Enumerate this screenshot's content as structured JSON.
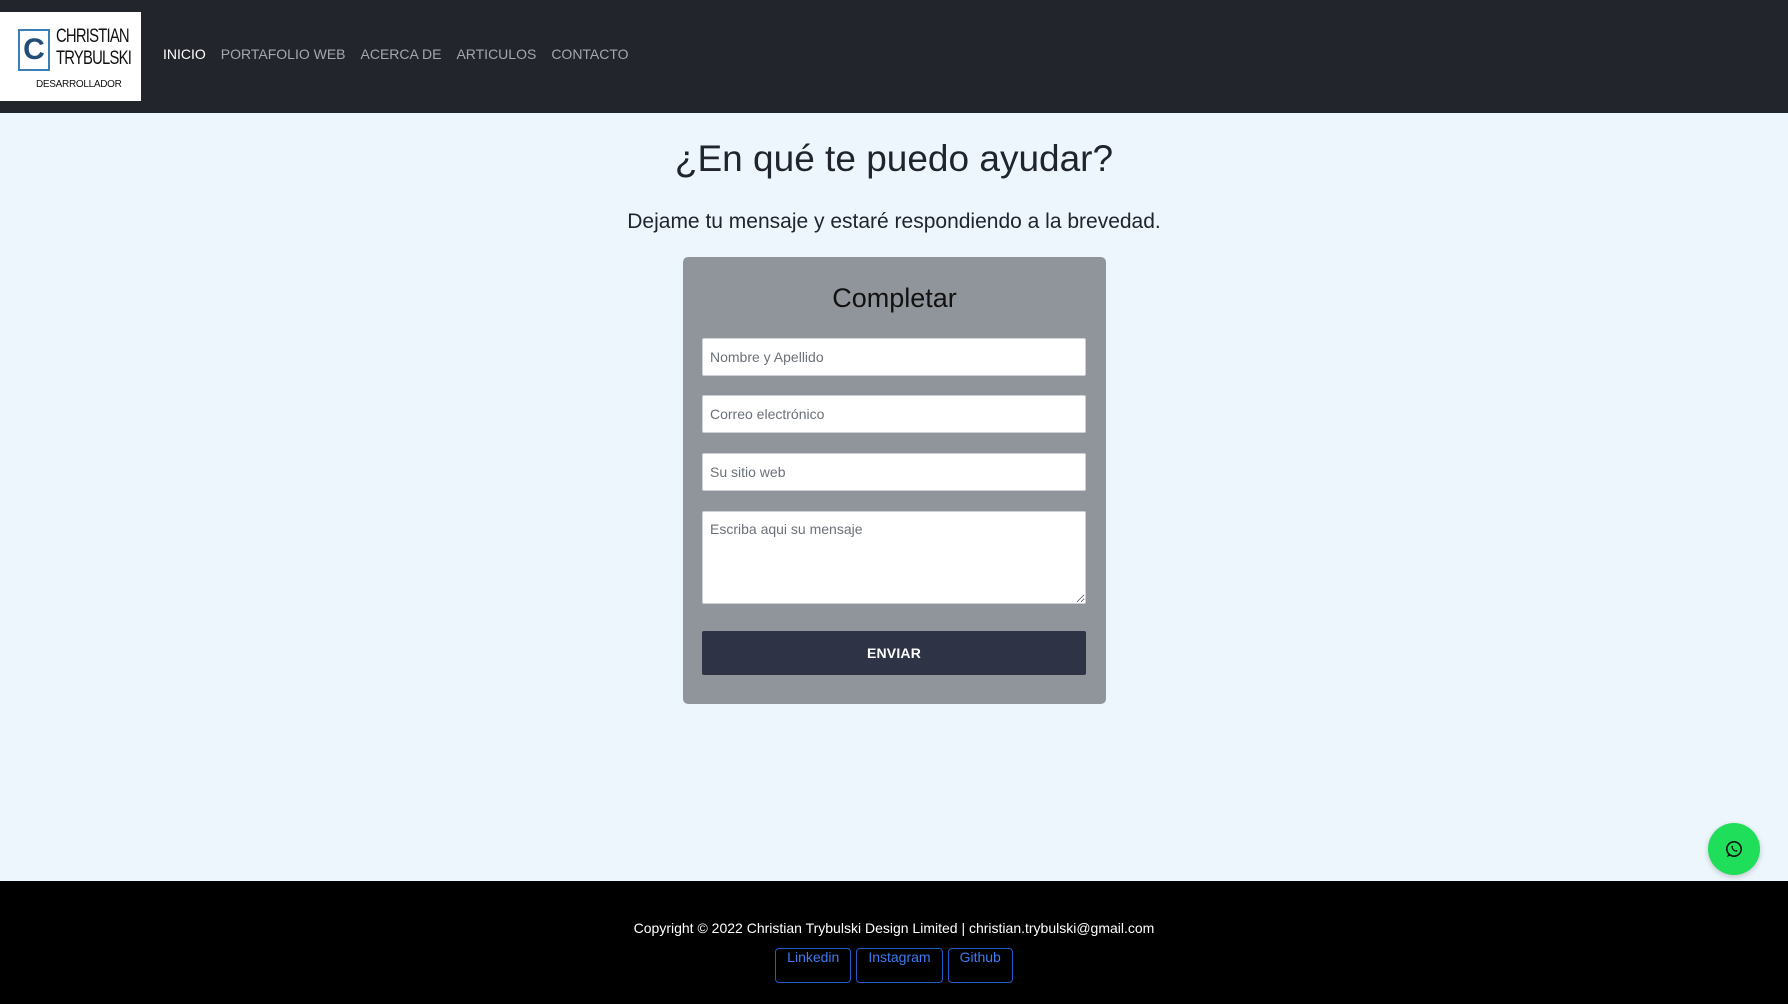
{
  "brand": {
    "initial": "C",
    "name_line1": "CHRISTIAN",
    "name_line2": "TRYBULSKI",
    "role": "DESARROLLADOR"
  },
  "nav": {
    "items": [
      {
        "label": "INICIO",
        "active": true
      },
      {
        "label": "PORTAFOLIO WEB",
        "active": false
      },
      {
        "label": "ACERCA DE",
        "active": false
      },
      {
        "label": "ARTICULOS",
        "active": false
      },
      {
        "label": "CONTACTO",
        "active": false
      }
    ]
  },
  "hero": {
    "title": "¿En qué te puedo ayudar?",
    "subtitle": "Dejame tu mensaje y estaré respondiendo a la brevedad."
  },
  "form": {
    "title": "Completar",
    "name_placeholder": "Nombre y Apellido",
    "email_placeholder": "Correo electrónico",
    "website_placeholder": "Su sitio web",
    "message_placeholder": "Escriba aqui su mensaje",
    "submit_label": "ENVIAR"
  },
  "footer": {
    "copyright": "Copyright © 2022 Christian Trybulski Design Limited | christian.trybulski@gmail.com",
    "links": [
      "Linkedin",
      "Instagram",
      "Github"
    ]
  },
  "floating_button": {
    "icon": "whatsapp-icon",
    "color": "#1fde59"
  },
  "colors": {
    "navbar": "#22252b",
    "page_background": "#eef6fd",
    "form_card": "#90959b",
    "submit_button": "#2e3346",
    "footer": "#000000",
    "link": "#3d7cf2"
  }
}
